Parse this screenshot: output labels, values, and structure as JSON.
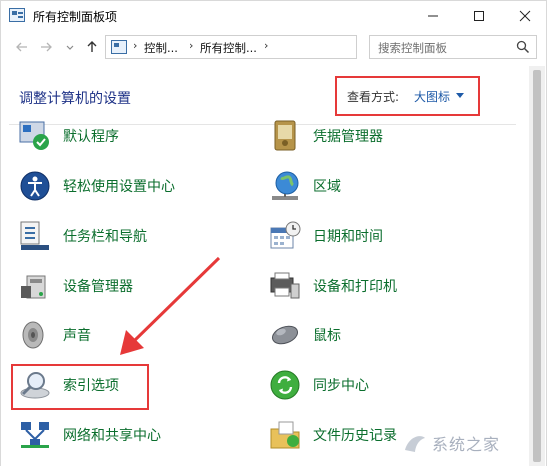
{
  "window": {
    "title": "所有控制面板项"
  },
  "navbar": {
    "breadcrumbs": [
      "控制...",
      "所有控制..."
    ],
    "search_placeholder": "搜索控制面板"
  },
  "content": {
    "heading": "调整计算机的设置",
    "view_label": "查看方式:",
    "view_value": "大图标"
  },
  "items": [
    {
      "label": "默认程序",
      "icon": "default-programs-icon"
    },
    {
      "label": "凭据管理器",
      "icon": "credential-manager-icon"
    },
    {
      "label": "轻松使用设置中心",
      "icon": "ease-of-access-icon"
    },
    {
      "label": "区域",
      "icon": "region-globe-icon"
    },
    {
      "label": "任务栏和导航",
      "icon": "taskbar-navigation-icon"
    },
    {
      "label": "日期和时间",
      "icon": "date-time-icon"
    },
    {
      "label": "设备管理器",
      "icon": "device-manager-icon"
    },
    {
      "label": "设备和打印机",
      "icon": "devices-printers-icon"
    },
    {
      "label": "声音",
      "icon": "sound-speaker-icon"
    },
    {
      "label": "鼠标",
      "icon": "mouse-icon"
    },
    {
      "label": "索引选项",
      "icon": "indexing-options-icon"
    },
    {
      "label": "同步中心",
      "icon": "sync-center-icon"
    },
    {
      "label": "网络和共享中心",
      "icon": "network-sharing-icon"
    },
    {
      "label": "文件历史记录",
      "icon": "file-history-icon"
    }
  ],
  "watermark": {
    "text": "系统之家"
  },
  "colors": {
    "link_green": "#0b6e2d",
    "heading_blue": "#1e3287",
    "highlight_red": "#e63939"
  }
}
